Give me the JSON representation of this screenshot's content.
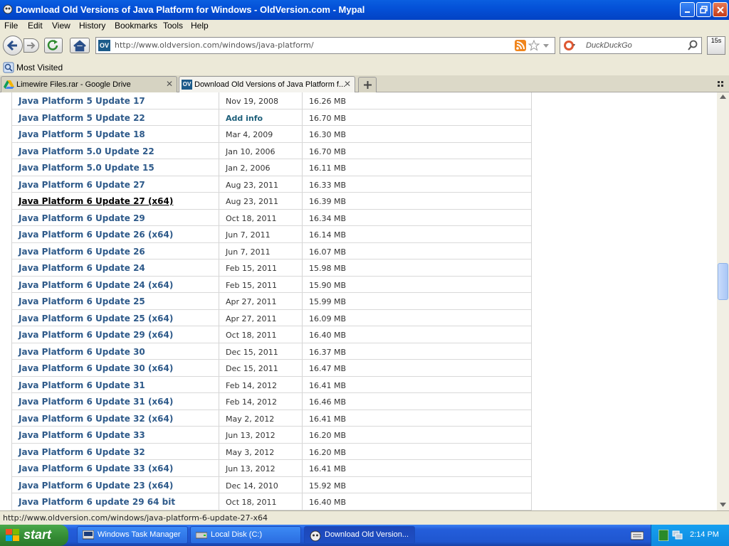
{
  "window": {
    "title": "Download Old Versions of Java Platform for Windows - OldVersion.com - Mypal"
  },
  "menu": [
    "File",
    "Edit",
    "View",
    "History",
    "Bookmarks",
    "Tools",
    "Help"
  ],
  "nav": {
    "favicon_text": "OV",
    "url": "http://www.oldversion.com/windows/java-platform/",
    "search_placeholder": "DuckDuckGo",
    "badge": "15s"
  },
  "bookmarks": {
    "most_visited": "Most Visited"
  },
  "tabs": [
    {
      "label": "Limewire Files.rar - Google Drive"
    },
    {
      "label": "Download Old Versions of Java Platform f..."
    }
  ],
  "versions": [
    {
      "name": "Java Platform 5 Update 17",
      "date": "Nov 19, 2008",
      "size": "16.26 MB"
    },
    {
      "name": "Java Platform 5 Update 22",
      "date": "Add info",
      "size": "16.70 MB"
    },
    {
      "name": "Java Platform 5 Update 18",
      "date": "Mar 4, 2009",
      "size": "16.30 MB"
    },
    {
      "name": "Java Platform 5.0 Update 22",
      "date": "Jan 10, 2006",
      "size": "16.70 MB"
    },
    {
      "name": "Java Platform 5.0 Update 15",
      "date": "Jan 2, 2006",
      "size": "16.11 MB"
    },
    {
      "name": "Java Platform 6 Update 27",
      "date": "Aug 23, 2011",
      "size": "16.33 MB"
    },
    {
      "name": "Java Platform 6 Update 27 (x64)",
      "date": "Aug 23, 2011",
      "size": "16.39 MB"
    },
    {
      "name": "Java Platform 6 Update 29",
      "date": "Oct 18, 2011",
      "size": "16.34 MB"
    },
    {
      "name": "Java Platform 6 Update 26 (x64)",
      "date": "Jun 7, 2011",
      "size": "16.14 MB"
    },
    {
      "name": "Java Platform 6 Update 26",
      "date": "Jun 7, 2011",
      "size": "16.07 MB"
    },
    {
      "name": "Java Platform 6 Update 24",
      "date": "Feb 15, 2011",
      "size": "15.98 MB"
    },
    {
      "name": "Java Platform 6 Update 24 (x64)",
      "date": "Feb 15, 2011",
      "size": "15.90 MB"
    },
    {
      "name": "Java Platform 6 Update 25",
      "date": "Apr 27, 2011",
      "size": "15.99 MB"
    },
    {
      "name": "Java Platform 6 Update 25 (x64)",
      "date": "Apr 27, 2011",
      "size": "16.09 MB"
    },
    {
      "name": "Java Platform 6 Update 29 (x64)",
      "date": "Oct 18, 2011",
      "size": "16.40 MB"
    },
    {
      "name": "Java Platform 6 Update 30",
      "date": "Dec 15, 2011",
      "size": "16.37 MB"
    },
    {
      "name": "Java Platform 6 Update 30 (x64)",
      "date": "Dec 15, 2011",
      "size": "16.47 MB"
    },
    {
      "name": "Java Platform 6 Update 31",
      "date": "Feb 14, 2012",
      "size": "16.41 MB"
    },
    {
      "name": "Java Platform 6 Update 31 (x64)",
      "date": "Feb 14, 2012",
      "size": "16.46 MB"
    },
    {
      "name": "Java Platform 6 Update 32 (x64)",
      "date": "May 2, 2012",
      "size": "16.41 MB"
    },
    {
      "name": "Java Platform 6 Update 33",
      "date": "Jun 13, 2012",
      "size": "16.20 MB"
    },
    {
      "name": "Java Platform 6 Update 32",
      "date": "May 3, 2012",
      "size": "16.20 MB"
    },
    {
      "name": "Java Platform 6 Update 33 (x64)",
      "date": "Jun 13, 2012",
      "size": "16.41 MB"
    },
    {
      "name": "Java Platform 6 Update 23 (x64)",
      "date": "Dec 14, 2010",
      "size": "15.92 MB"
    },
    {
      "name": "Java Platform 6 update 29 64 bit",
      "date": "Oct 18, 2011",
      "size": "16.40 MB"
    }
  ],
  "status": {
    "text": "http://www.oldversion.com/windows/java-platform-6-update-27-x64"
  },
  "taskbar": {
    "start": "start",
    "items": [
      {
        "label": "Windows Task Manager"
      },
      {
        "label": "Local Disk (C:)"
      },
      {
        "label": "Download Old Version..."
      }
    ],
    "clock": "2:14 PM"
  }
}
